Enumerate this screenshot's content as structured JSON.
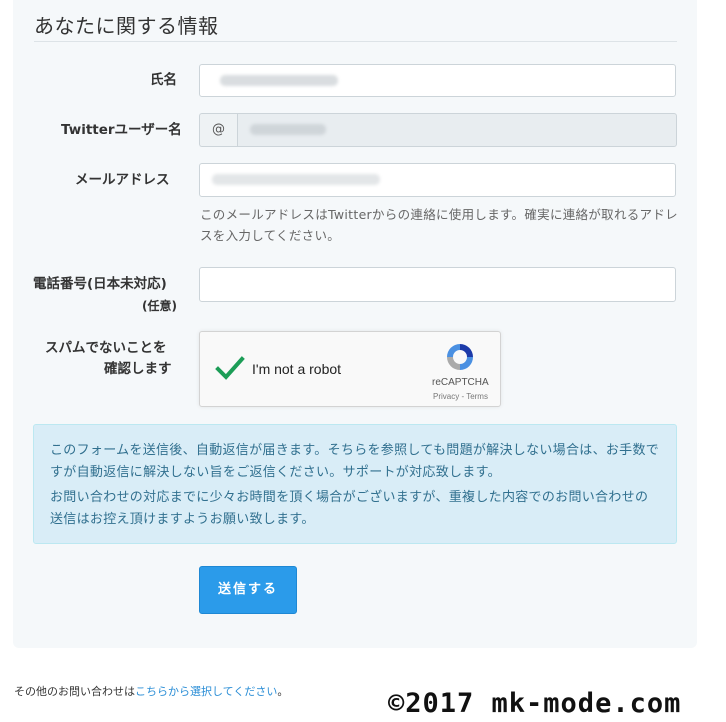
{
  "section": {
    "title": "あなたに関する情報"
  },
  "fields": {
    "name": {
      "label": "氏名"
    },
    "twitter": {
      "label": "Twitterユーザー名",
      "prefix": "@"
    },
    "email": {
      "label": "メールアドレス",
      "help": "このメールアドレスはTwitterからの連絡に使用します。確実に連絡が取れるアドレスを入力してください。"
    },
    "phone": {
      "label": "電話番号(日本未対応)",
      "sublabel": "(任意)"
    }
  },
  "captcha": {
    "label_line1": "スパムでないことを",
    "label_line2": "確認します",
    "text": "I'm not a robot",
    "brand": "reCAPTCHA",
    "links": "Privacy - Terms"
  },
  "notice": {
    "para1": "このフォームを送信後、自動返信が届きます。そちらを参照しても問題が解決しない場合は、お手数ですが自動返信に解決しない旨をご返信ください。サポートが対応致します。",
    "para2": "お問い合わせの対応までに少々お時間を頂く場合がございますが、重複した内容でのお問い合わせの送信はお控え頂けますようお願い致します。"
  },
  "submit_label": "送信する",
  "footer": {
    "prefix": "その他のお問い合わせは",
    "link": "こちらから選択してください",
    "suffix": "。"
  },
  "watermark": "©2017 mk-mode.com",
  "colors": {
    "accent": "#2b9bea",
    "notice_bg": "#d9edf7",
    "notice_text": "#31708f",
    "check": "#1c9d57"
  }
}
